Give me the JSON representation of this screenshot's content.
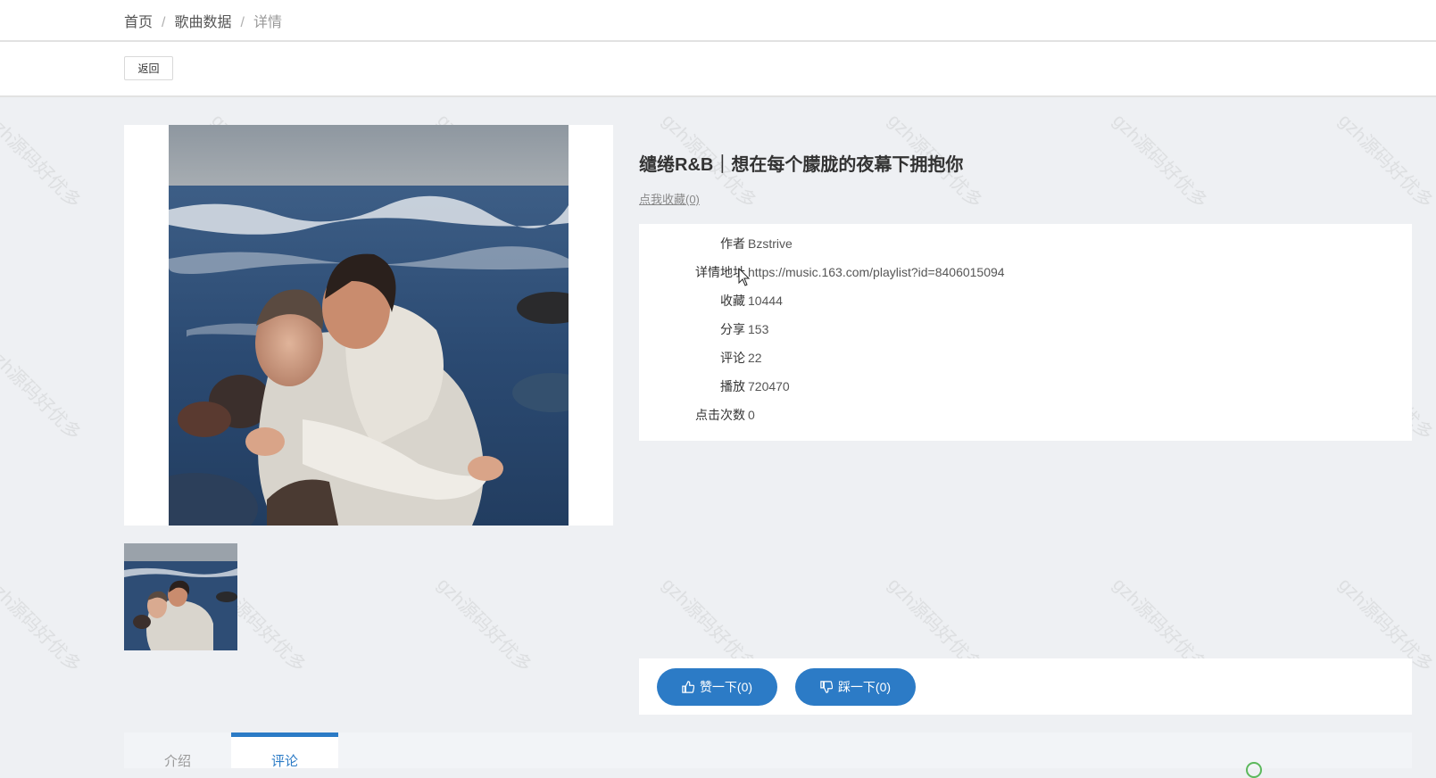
{
  "breadcrumb": {
    "home": "首页",
    "section": "歌曲数据",
    "current": "详情",
    "separator": "/"
  },
  "toolbar": {
    "back_label": "返回"
  },
  "detail": {
    "title": "缱绻R&B｜想在每个朦胧的夜幕下拥抱你",
    "favorite_link": "点我收藏(0)",
    "fields": [
      {
        "label": "作者",
        "value": "Bzstrive"
      },
      {
        "label": "详情地址",
        "value": "https://music.163.com/playlist?id=8406015094"
      },
      {
        "label": "收藏",
        "value": "10444"
      },
      {
        "label": "分享",
        "value": "153"
      },
      {
        "label": "评论",
        "value": "22"
      },
      {
        "label": "播放",
        "value": "720470"
      },
      {
        "label": "点击次数",
        "value": "0"
      }
    ]
  },
  "votes": {
    "like_label": "赞一下(0)",
    "dislike_label": "踩一下(0)"
  },
  "tabs": [
    {
      "label": "介绍",
      "active": false
    },
    {
      "label": "评论",
      "active": true
    }
  ],
  "watermark_text": "gzh源码好优多",
  "colors": {
    "accent": "#2c7bc6",
    "background": "#eef0f3"
  }
}
